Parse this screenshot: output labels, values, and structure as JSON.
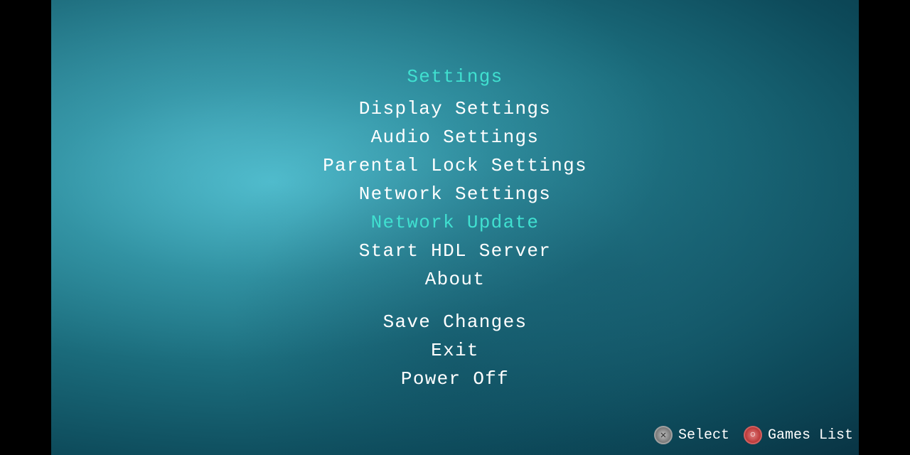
{
  "menu": {
    "title": "Settings",
    "items": [
      {
        "label": "Display Settings",
        "highlighted": false
      },
      {
        "label": "Audio Settings",
        "highlighted": false
      },
      {
        "label": "Parental Lock Settings",
        "highlighted": false
      },
      {
        "label": "Network Settings",
        "highlighted": false
      },
      {
        "label": "Network Update",
        "highlighted": true
      },
      {
        "label": "Start HDL Server",
        "highlighted": false
      },
      {
        "label": "About",
        "highlighted": false
      }
    ],
    "actions": [
      {
        "label": "Save Changes"
      },
      {
        "label": "Exit"
      },
      {
        "label": "Power Off"
      }
    ]
  },
  "controls": {
    "select": {
      "icon": "✕",
      "label": "Select"
    },
    "games_list": {
      "icon": "○",
      "label": "Games List"
    }
  },
  "colors": {
    "title": "#40e0d0",
    "highlighted": "#40e0d0",
    "normal": "#ffffff"
  }
}
